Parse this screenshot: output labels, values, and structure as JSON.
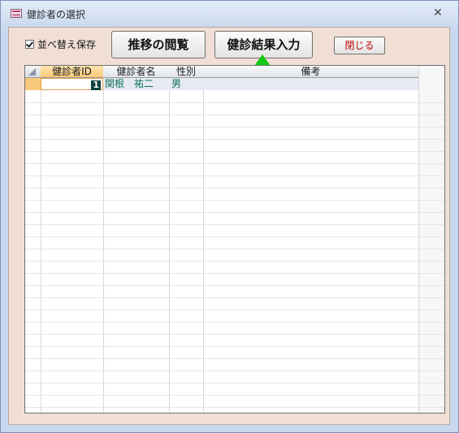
{
  "window": {
    "title": "健診者の選択"
  },
  "toolbar": {
    "sort_save_label": "並べ替え保存",
    "sort_save_checked": true,
    "trend_button_label": "推移の閲覧",
    "result_button_label": "健診結果入力",
    "close_button_label": "閉じる"
  },
  "grid": {
    "columns": [
      "健診者ID",
      "健診者名",
      "性別",
      "備考"
    ],
    "rows": [
      {
        "id": "1",
        "name": "関根　祐二",
        "gender": "男",
        "note": ""
      }
    ]
  },
  "colors": {
    "form_background": "#f1dfd6",
    "header_selected": "#f8c87a",
    "arrow": "#12c812",
    "close_text": "#c00000"
  }
}
